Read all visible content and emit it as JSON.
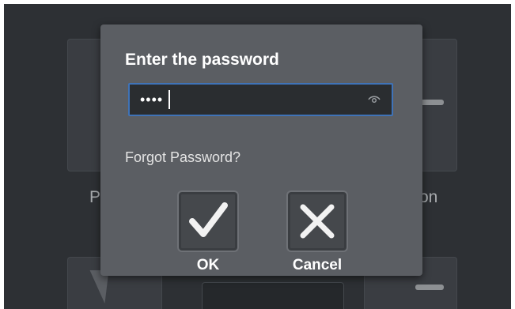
{
  "dialog": {
    "title": "Enter the password",
    "password_value": "••••",
    "forgot_link": "Forgot Password?",
    "ok_label": "OK",
    "cancel_label": "Cancel"
  },
  "background": {
    "left_label": "P",
    "right_label": "on"
  },
  "icons": {
    "password_toggle": "eye-icon",
    "ok": "checkmark-icon",
    "cancel": "x-close-icon"
  },
  "colors": {
    "screen_bg": "#2d3034",
    "dialog_bg": "#5b5e63",
    "field_border": "#3f73b8",
    "field_bg": "#2a2d30",
    "button_bg": "#45484c"
  }
}
